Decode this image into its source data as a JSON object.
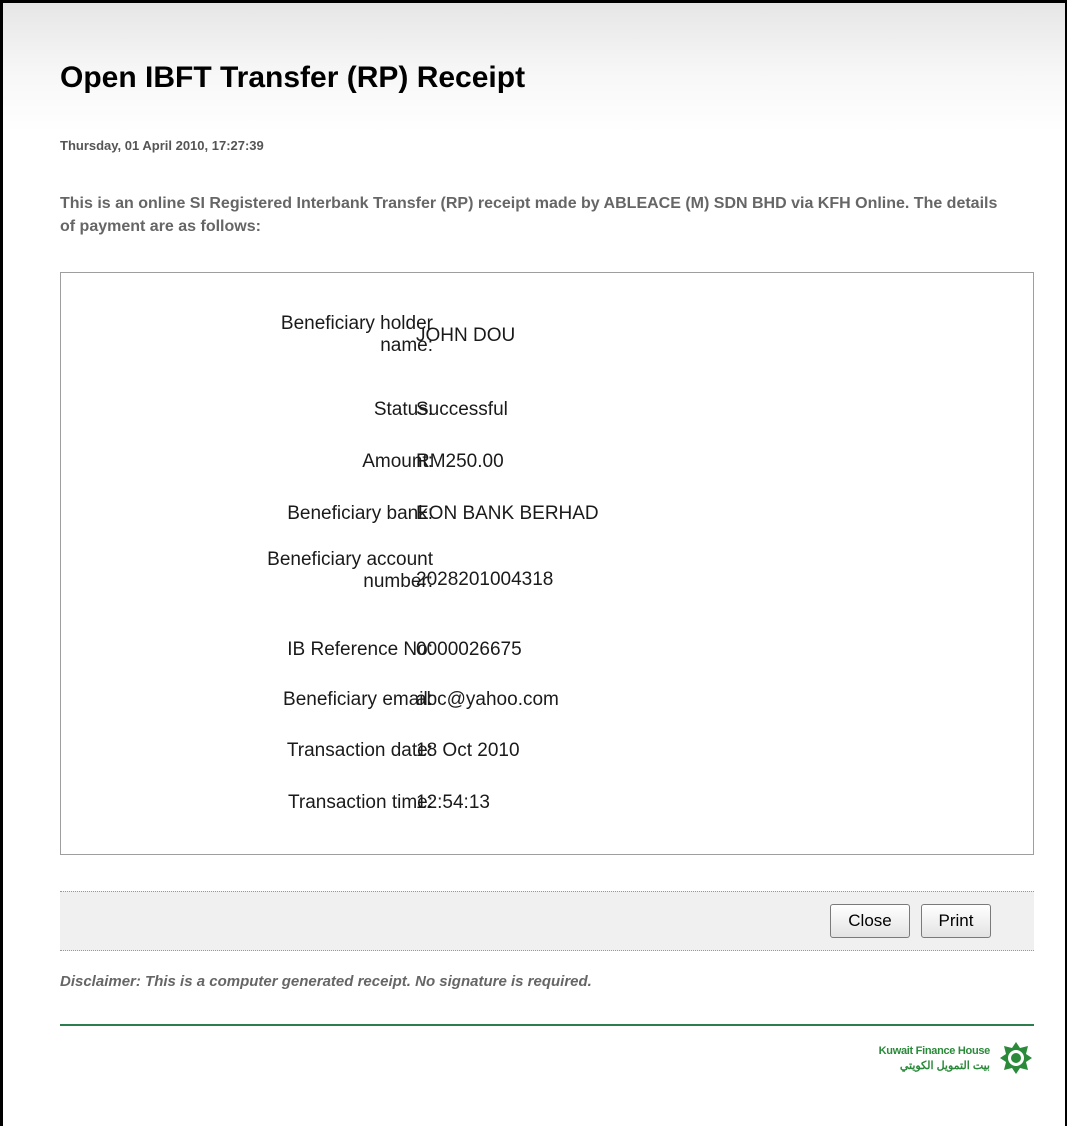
{
  "page": {
    "title": "Open IBFT Transfer (RP) Receipt",
    "timestamp": "Thursday, 01 April 2010, 17:27:39",
    "intro": "This is an online SI Registered Interbank Transfer (RP) receipt made by ABLEACE (M) SDN BHD via KFH Online. The details of payment are as follows:"
  },
  "details": [
    {
      "label": "Beneficiary holder name:",
      "value": "JOHN DOU"
    },
    {
      "label": "Status:",
      "value": "Successful"
    },
    {
      "label": "Amount:",
      "value": "RM250.00"
    },
    {
      "label": "Beneficiary bank:",
      "value": "EON BANK BERHAD"
    },
    {
      "label": "Beneficiary account number:",
      "value": "2028201004318"
    },
    {
      "label": "IB Reference No:",
      "value": "0000026675"
    },
    {
      "label": "Beneficiary email:",
      "value": "abc@yahoo.com"
    },
    {
      "label": "Transaction date:",
      "value": "18 Oct 2010"
    },
    {
      "label": "Transaction time:",
      "value": "12:54:13"
    }
  ],
  "buttons": {
    "close_label": "Close",
    "print_label": "Print"
  },
  "disclaimer": "Disclaimer: This is a computer generated receipt. No signature is required.",
  "logo": {
    "name_en": "Kuwait Finance House",
    "name_ar": "بيت التمويل الكويتي",
    "icon": "kfh-emblem-icon"
  },
  "colors": {
    "accent_green": "#2e7d4f",
    "logo_green": "#2a8a3a"
  }
}
